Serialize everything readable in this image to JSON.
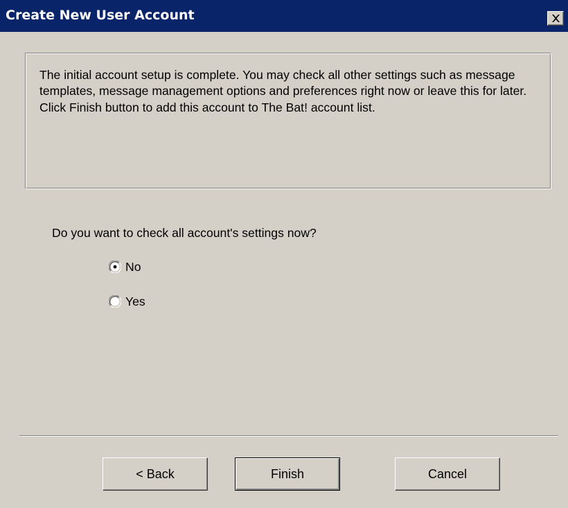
{
  "window": {
    "title": "Create New User Account",
    "close_icon": "close-icon"
  },
  "info_panel": {
    "text": "The initial account setup is complete. You may check all other settings such as message templates, message management options and preferences right now or leave this for later. Click Finish button to add this account to The Bat! account list."
  },
  "question": {
    "text": "Do you want to check all account's settings now?",
    "options": [
      {
        "label": "No",
        "selected": true
      },
      {
        "label": "Yes",
        "selected": false
      }
    ]
  },
  "buttons": {
    "back": "< Back",
    "finish": "Finish",
    "cancel": "Cancel"
  },
  "colors": {
    "titlebar": "#0a246a",
    "dialog_face": "#d4d0c8"
  }
}
